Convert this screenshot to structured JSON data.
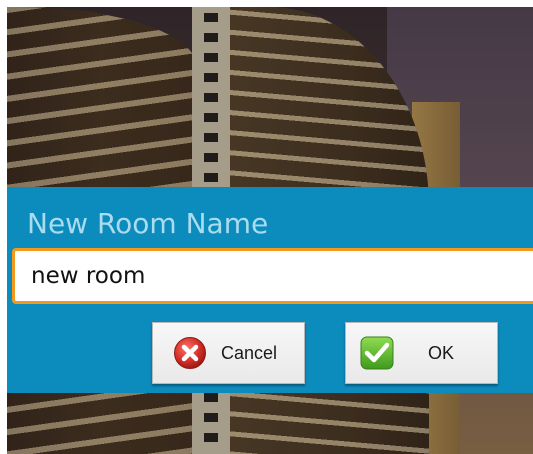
{
  "dialog": {
    "title": "New Room Name",
    "input_value": "new room",
    "cancel_label": "Cancel",
    "ok_label": "OK"
  },
  "icons": {
    "cancel": "cancel-x-icon",
    "ok": "checkmark-icon"
  },
  "colors": {
    "dialog_background": "#0c8bbd",
    "title_text": "#a9dcef",
    "input_focus_border": "#f39a1e",
    "cancel_icon": "#d9322a",
    "ok_icon": "#58b52c"
  }
}
